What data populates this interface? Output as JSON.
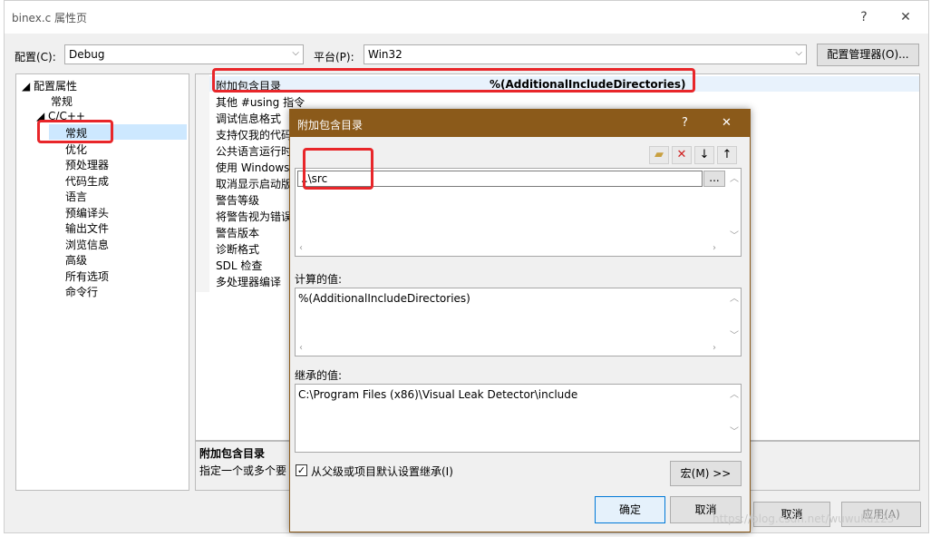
{
  "window": {
    "title": "binex.c 属性页",
    "help_glyph": "?",
    "close_glyph": "✕"
  },
  "config": {
    "config_label": "配置(C):",
    "config_value": "Debug",
    "platform_label": "平台(P):",
    "platform_value": "Win32",
    "manager_button": "配置管理器(O)..."
  },
  "tree": {
    "root": "配置属性",
    "general": "常规",
    "cpp": "C/C++",
    "cpp_children": [
      "常规",
      "优化",
      "预处理器",
      "代码生成",
      "语言",
      "预编译头",
      "输出文件",
      "浏览信息",
      "高级",
      "所有选项",
      "命令行"
    ]
  },
  "grid": {
    "rows": [
      {
        "name": "附加包含目录",
        "value": "%(AdditionalIncludeDirectories)"
      },
      {
        "name": "其他 #using 指令",
        "value": ""
      },
      {
        "name": "调试信息格式",
        "value": ""
      },
      {
        "name": "支持仅我的代码",
        "value": ""
      },
      {
        "name": "公共语言运行时",
        "value": ""
      },
      {
        "name": "使用 Windows",
        "value": ""
      },
      {
        "name": "取消显示启动版",
        "value": ""
      },
      {
        "name": "警告等级",
        "value": ""
      },
      {
        "name": "将警告视为错误",
        "value": ""
      },
      {
        "name": "警告版本",
        "value": ""
      },
      {
        "name": "诊断格式",
        "value": ""
      },
      {
        "name": "SDL 检查",
        "value": ""
      },
      {
        "name": "多处理器编译",
        "value": ""
      }
    ]
  },
  "description": {
    "title": "附加包含目录",
    "text": "指定一个或多个要"
  },
  "bottom_buttons": {
    "cancel": "取消",
    "apply": "应用(A)"
  },
  "dialog": {
    "title": "附加包含目录",
    "help_glyph": "?",
    "close_glyph": "✕",
    "entry_value": "..\\src",
    "browse": "...",
    "computed_label": "计算的值:",
    "computed_value": "%(AdditionalIncludeDirectories)",
    "inherited_label": "继承的值:",
    "inherited_value": "C:\\Program Files (x86)\\Visual Leak Detector\\include",
    "inherit_checkbox": "从父级或项目默认设置继承(I)",
    "macro_button": "宏(M) >>",
    "ok_button": "确定",
    "cancel_button": "取消"
  },
  "watermark": "https://blog.csdn.net/wuwuku123"
}
